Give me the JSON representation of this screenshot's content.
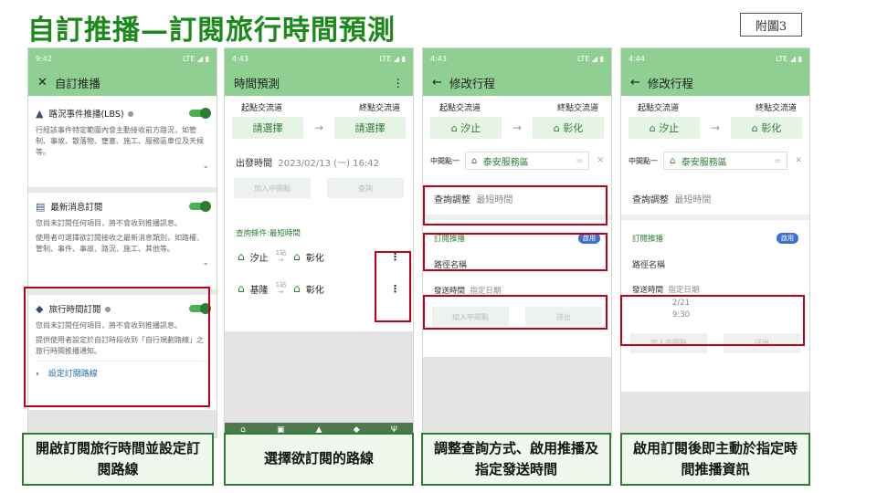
{
  "title": "自訂推播—訂閱旅行時間預測",
  "figure_label": "附圖3",
  "screen1": {
    "status_time": "9:42",
    "status_right": "LTE ◢ ▮",
    "header": "自訂推播",
    "cards": [
      {
        "label": "路況事件推播(LBS)",
        "desc": "行經該事件特定範圍內會主動接收前方路況，如管制、事故、散落物、壅塞、施工、服務區車位及天候等。"
      },
      {
        "label": "最新消息訂閱",
        "desc": "您尚未訂閱任何項目，將不會收到推播訊息。",
        "desc2": "使用者可選擇欲訂閱接收之最新消息類別，如路權、管制、事件、事故、路況、施工、其他等。"
      },
      {
        "label": "旅行時間訂閱",
        "desc": "您尚未訂閱任何項目，將不會收到推播訊息。",
        "desc2": "提供使用者設定於自訂時段收到「自行規劃路線」之旅行時間推播通知。",
        "link": "設定訂閱路線"
      }
    ]
  },
  "screen2": {
    "status_time": "4:43",
    "status_right": "LTE ◢ ▮",
    "header": "時間預測",
    "origin_label": "起點交流道",
    "dest_label": "終點交流道",
    "origin_value": "請選擇",
    "dest_value": "請選擇",
    "depart_label": "出發時間",
    "depart_value": "2023/02/13 (一) 16:42",
    "btn_add": "加入中間點",
    "btn_query": "查詢",
    "condition": "查詢條件:最短時間",
    "routes": [
      {
        "from": "汐止",
        "stops": "1站",
        "to": "彰化"
      },
      {
        "from": "基隆",
        "stops": "1站",
        "to": "彰化"
      }
    ]
  },
  "screen3": {
    "status_time": "4:43",
    "status_right": "LTE ◢ ▮",
    "header": "修改行程",
    "origin_label": "起點交流道",
    "dest_label": "終點交流道",
    "origin_value": "汐止",
    "dest_value": "彰化",
    "mid_label": "中間點一",
    "mid_value": "泰安服務區",
    "query_label": "查詢調整",
    "query_value": "最短時間",
    "push_label": "訂閱推播",
    "badge": "啟用",
    "route_name_label": "路徑名稱",
    "send_label": "發送時間",
    "send_value": "指定日期",
    "btn_add": "加入中間點",
    "btn_send": "送出"
  },
  "screen4": {
    "status_time": "4:44",
    "status_right": "LTE ◢ ▮",
    "header": "修改行程",
    "origin_label": "起點交流道",
    "dest_label": "終點交流道",
    "origin_value": "汐止",
    "dest_value": "彰化",
    "mid_label": "中間點一",
    "mid_value": "泰安服務區",
    "query_label": "查詢調整",
    "query_value": "最短時間",
    "push_label": "訂閱推播",
    "badge": "啟用",
    "route_name_label": "路徑名稱",
    "send_label": "發送時間",
    "send_value": "指定日期",
    "send_date": "2/21",
    "send_time": "9:30",
    "btn_add": "加入中間點",
    "btn_send": "送出"
  },
  "captions": [
    "開啟訂閱旅行時間並設定訂閱路線",
    "選擇欲訂閱的路線",
    "調整查詢方式、啟用推播及指定發送時間",
    "啟用訂閱後即主動於指定時間推播資訊"
  ]
}
